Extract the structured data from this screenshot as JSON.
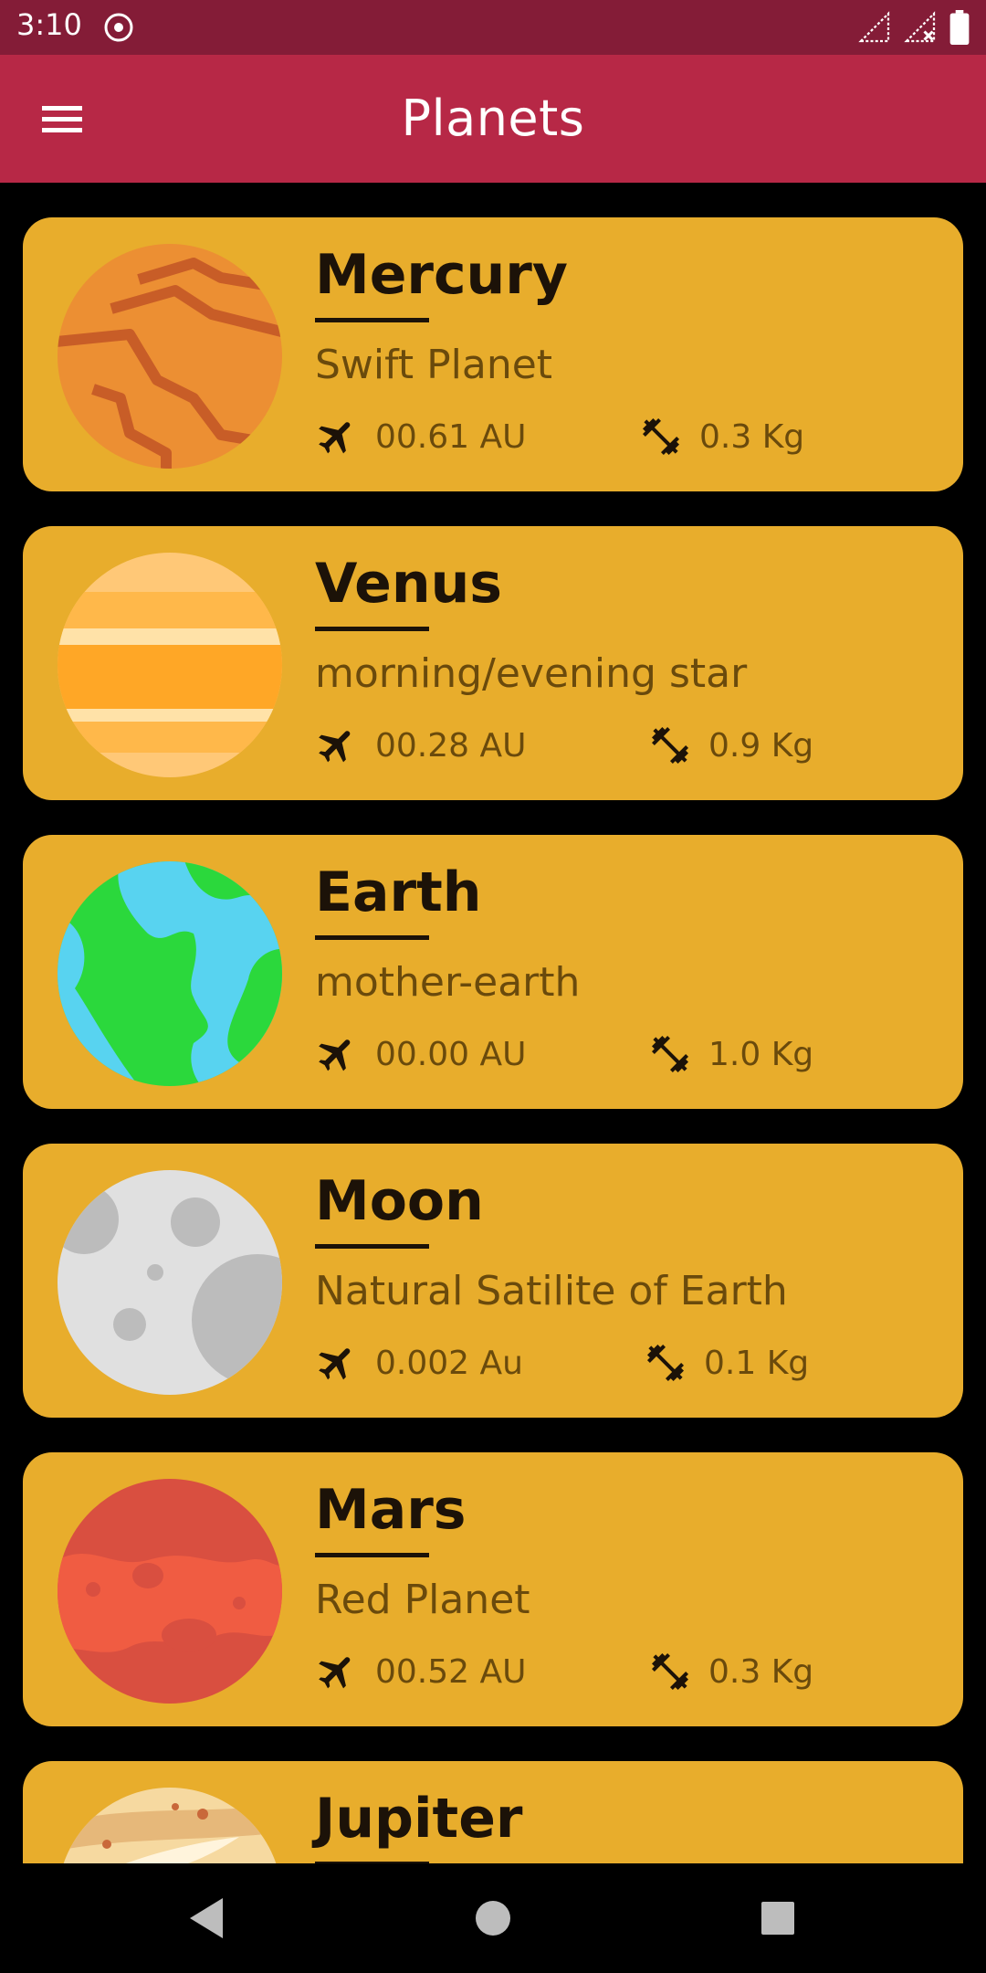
{
  "status_bar": {
    "time": "3:10",
    "left_icon": "notification-app-icon",
    "right_icons": [
      "signal-icon",
      "wifi-off-icon",
      "battery-icon"
    ]
  },
  "app_bar": {
    "title": "Planets",
    "menu_icon": "hamburger-menu-icon"
  },
  "stat_icons": {
    "distance": "airplane-icon",
    "weight": "dumbbell-icon"
  },
  "colors": {
    "status_bar": "#841c37",
    "app_bar": "#b72846",
    "card": "#e8ad2c",
    "background": "#000000",
    "title_text": "#1c1208",
    "secondary_text": "#6a4a0c"
  },
  "planets": [
    {
      "name": "Mercury",
      "subtitle": "Swift Planet",
      "distance": "00.61 AU",
      "weight": "0.3 Kg"
    },
    {
      "name": "Venus",
      "subtitle": "morning/evening star",
      "distance": "00.28 AU",
      "weight": "0.9 Kg"
    },
    {
      "name": "Earth",
      "subtitle": "mother-earth",
      "distance": "00.00 AU",
      "weight": "1.0 Kg"
    },
    {
      "name": "Moon",
      "subtitle": "Natural Satilite of Earth",
      "distance": "0.002 Au",
      "weight": "0.1 Kg"
    },
    {
      "name": "Mars",
      "subtitle": "Red Planet",
      "distance": "00.52 AU",
      "weight": "0.3 Kg"
    },
    {
      "name": "Jupiter",
      "subtitle": "",
      "distance": "",
      "weight": ""
    }
  ],
  "nav_bar": {
    "back": "back-triangle-icon",
    "home": "home-circle-icon",
    "recents": "recents-square-icon"
  }
}
